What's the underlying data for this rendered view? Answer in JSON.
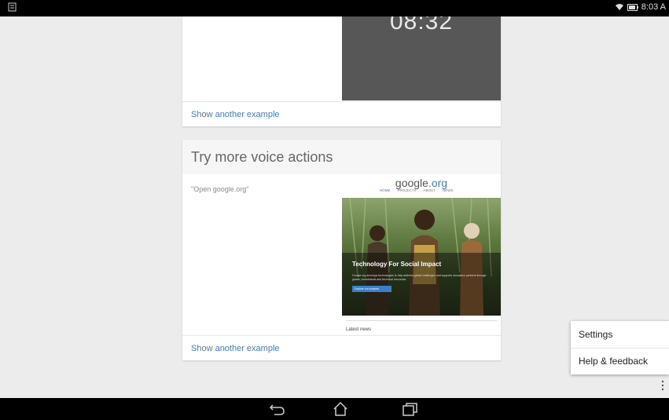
{
  "status_bar": {
    "time": "8:03 A",
    "left_icon": "notification-icon",
    "right_icons": [
      "wifi-icon",
      "battery-icon"
    ]
  },
  "clock_card": {
    "time_display": "08:32",
    "link_label": "Show another example"
  },
  "voice_card": {
    "title": "Try more voice actions",
    "example_command": "\"Open google.org\"",
    "link_label": "Show another example",
    "preview": {
      "logo_text": "google",
      "logo_suffix": ".org",
      "nav": [
        "HOME",
        "PROJECTS",
        "ABOUT",
        "NEWS"
      ],
      "hero_title": "Technology For Social Impact",
      "hero_subtitle": "Google.org develops technologies to help address global challenges and supports innovative partners through grants, investments and technical resources.",
      "hero_button": "Explore our projects",
      "latest_label": "Latest news"
    }
  },
  "overflow_menu": {
    "items": [
      "Settings",
      "Help & feedback"
    ]
  },
  "nav_bar": {
    "buttons": [
      "back-icon",
      "home-icon",
      "recent-apps-icon"
    ]
  },
  "colors": {
    "background": "#ececec",
    "link": "#3b7fcb",
    "clock_panel": "#575757"
  }
}
